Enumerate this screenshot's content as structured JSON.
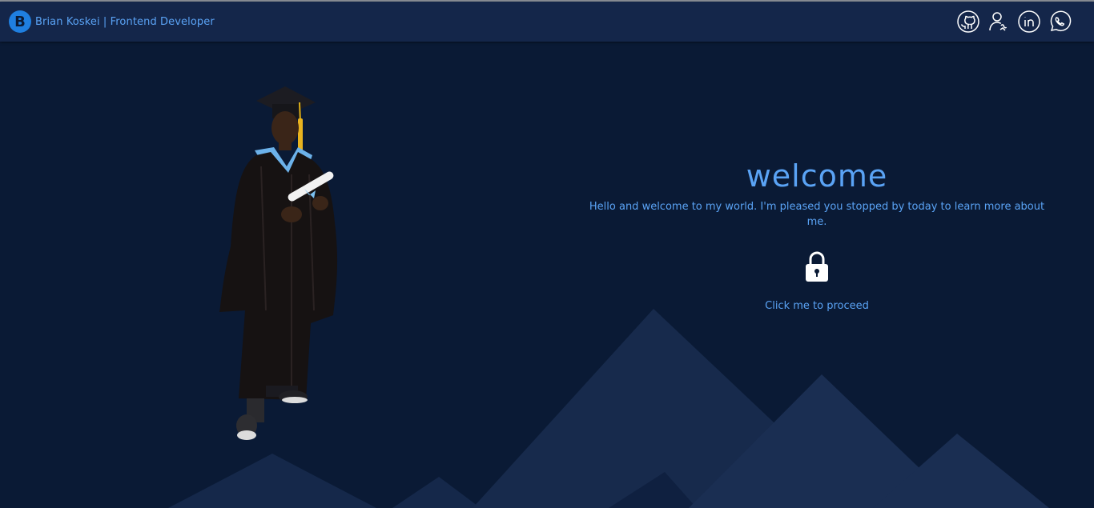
{
  "header": {
    "logo_letter": "B",
    "brand_text": "Brian Koskei | Frontend Developer",
    "social_icons": [
      "github-icon",
      "contact-icon",
      "linkedin-icon",
      "whatsapp-icon"
    ]
  },
  "hero": {
    "title": "welcome",
    "message": "Hello and welcome to my world. I'm pleased you stopped by today to learn more about me.",
    "lock_icon": "lock-icon",
    "proceed_text": "Click me to proceed"
  },
  "colors": {
    "background": "#0a1a35",
    "header": "#14264a",
    "accent": "#5aa3f5",
    "logo": "#1f7fe0",
    "mountain": "#172a4c"
  }
}
